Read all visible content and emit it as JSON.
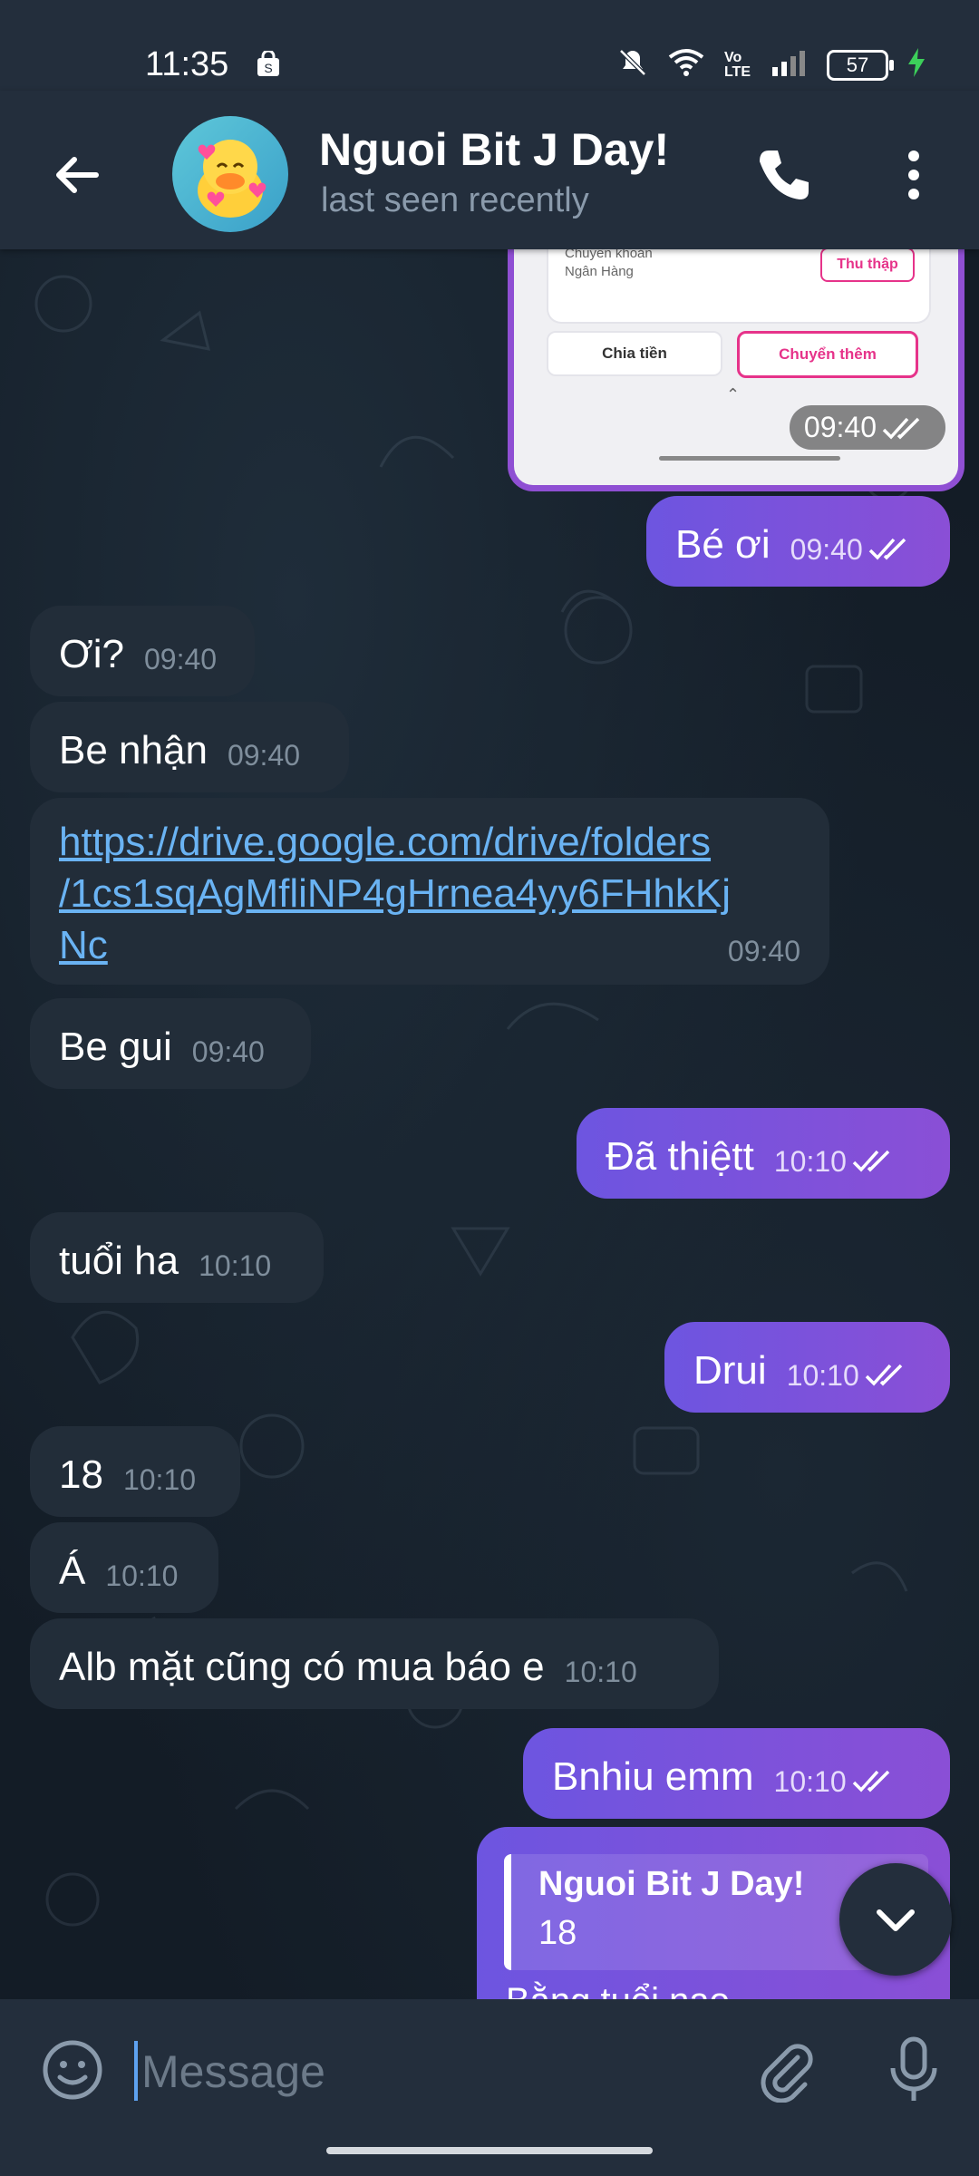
{
  "status_bar": {
    "time": "11:35",
    "battery": "57"
  },
  "header": {
    "title": "Nguoi Bit J Day!",
    "status": "last seen recently"
  },
  "screenshot_preview": {
    "card_label_1": "Chuyển khoản",
    "card_label_2": "Ngân Hàng",
    "collect_button": "Thu thập",
    "split_button": "Chia tiền",
    "transfer_button": "Chuyển thêm",
    "time": "09:40"
  },
  "messages": [
    {
      "text": "Bé ơi",
      "time": "09:40"
    },
    {
      "text": "Ơi?",
      "time": "09:40"
    },
    {
      "text": "Be nhận",
      "time": "09:40"
    },
    {
      "text": "https://drive.google.com/drive/folders/1cs1sqAgMfliNP4gHrnea4yy6FHhkKjNc",
      "line1": "https://drive.google.com/drive/folders",
      "line2": "/1cs1sqAgMfliNP4gHrnea4yy6FHhkKj",
      "line3": "Nc",
      "time": "09:40"
    },
    {
      "text": "Be gui",
      "time": "09:40"
    },
    {
      "text": "Đã thiệtt",
      "time": "10:10"
    },
    {
      "text": "tuổi ha",
      "time": "10:10"
    },
    {
      "text": "Drui",
      "time": "10:10"
    },
    {
      "text": "18",
      "time": "10:10"
    },
    {
      "text": "Á",
      "time": "10:10"
    },
    {
      "text": "Alb mặt cũng có mua báo e",
      "time": "10:10"
    },
    {
      "text": "Bnhiu emm",
      "time": "10:10"
    }
  ],
  "reply": {
    "author": "Nguoi Bit J Day!",
    "quoted": "18",
    "text": "Bằng tuổi nao"
  },
  "composer": {
    "placeholder": "Message"
  },
  "colors": {
    "outgoing": "#7b52dc",
    "incoming": "#222d39",
    "link": "#6ab3f3",
    "header": "#232e3c"
  }
}
